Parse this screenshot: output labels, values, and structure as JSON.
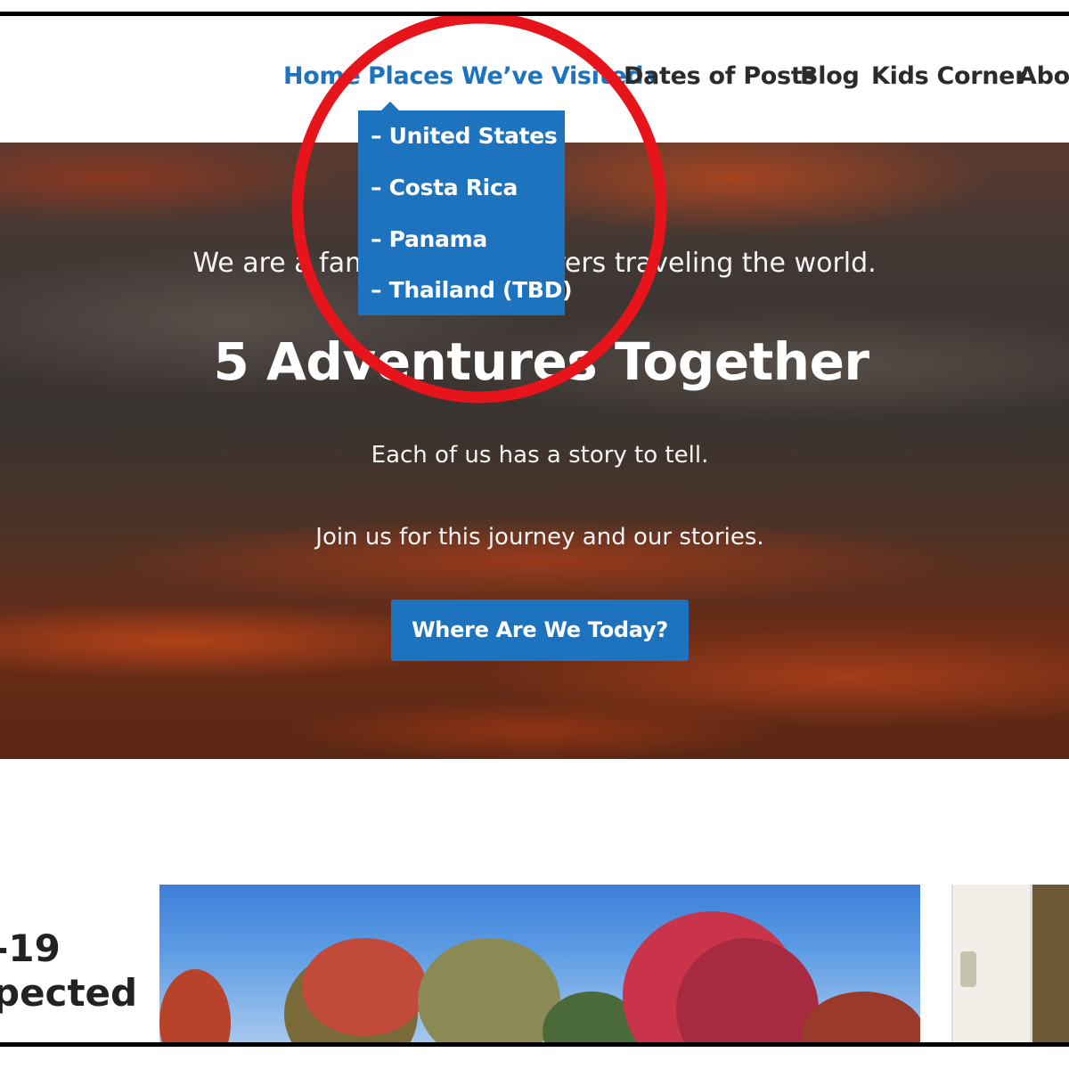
{
  "nav": {
    "items": [
      {
        "label": "Home",
        "active": true
      },
      {
        "label": "Places We’ve Visited",
        "active": true,
        "has_caret": true
      },
      {
        "label": "Dates of Posts",
        "active": false
      },
      {
        "label": "Blog",
        "active": false
      },
      {
        "label": "Kids Corner",
        "active": false
      },
      {
        "label": "About",
        "active": false
      }
    ],
    "caret_icon": "caret-down-icon"
  },
  "dropdown": {
    "items": [
      "– United States",
      "– Costa Rica",
      "– Panama",
      "– Thailand (TBD)"
    ]
  },
  "hero": {
    "intro": "We are a family of adventurers traveling the world.",
    "title": "5 Adventures Together",
    "line2": "Each of us has a story to tell.",
    "line3": "Join us for this journey and our stories.",
    "button_label": "Where Are We Today?"
  },
  "posts": {
    "partial_title": "-19\npected"
  },
  "colors": {
    "accent": "#1e73be",
    "annotation": "#e8141c",
    "nav_text": "#2b2b2b"
  }
}
